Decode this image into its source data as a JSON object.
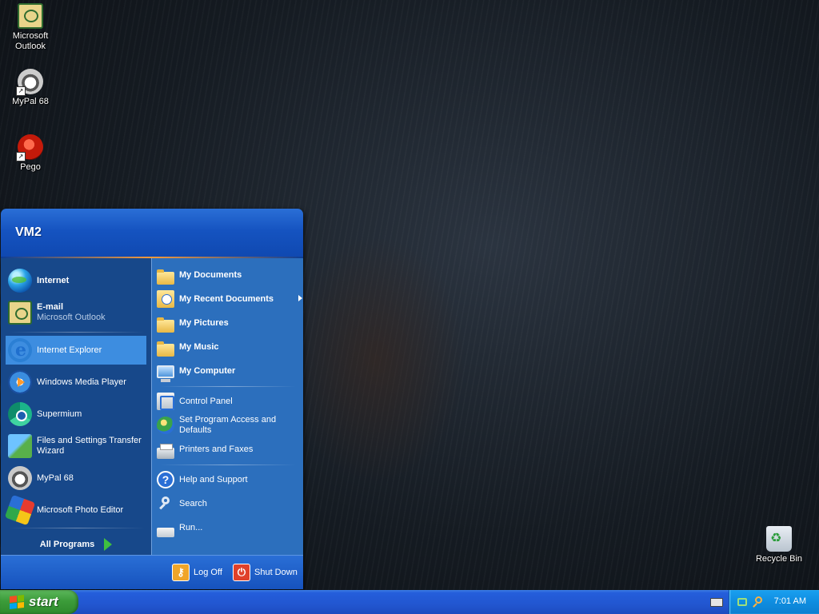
{
  "desktop": {
    "icons": [
      {
        "label_line1": "Microsoft",
        "label_line2": "Outlook",
        "icon": "outlook-icon"
      },
      {
        "label_line1": "MyPal 68",
        "label_line2": "",
        "icon": "mypal-icon"
      },
      {
        "label_line1": "Pego",
        "label_line2": "",
        "icon": "pego-icon"
      },
      {
        "label_line1": "Recycle Bin",
        "label_line2": "",
        "icon": "recycle-bin-icon"
      }
    ]
  },
  "start_menu": {
    "user_name": "VM2",
    "left": {
      "pinned": [
        {
          "title": "Internet",
          "icon": "globe-icon"
        },
        {
          "title": "E-mail",
          "subtitle": "Microsoft Outlook",
          "icon": "outlook-icon"
        }
      ],
      "recent": [
        {
          "title": "Internet Explorer",
          "icon": "internet-explorer-icon",
          "selected": true
        },
        {
          "title": "Windows Media Player",
          "icon": "media-player-icon"
        },
        {
          "title": "Supermium",
          "icon": "supermium-icon"
        },
        {
          "title_line1": "Files and Settings Transfer",
          "title_line2": "Wizard",
          "icon": "transfer-wizard-icon"
        },
        {
          "title": "MyPal 68",
          "icon": "mypal-icon"
        },
        {
          "title": "Microsoft Photo Editor",
          "icon": "photo-editor-icon"
        }
      ],
      "all_programs": "All Programs"
    },
    "right": {
      "items": [
        {
          "title": "My Documents",
          "icon": "folder-icon"
        },
        {
          "title": "My Recent Documents",
          "icon": "recent-documents-icon"
        },
        {
          "title": "My Pictures",
          "icon": "pictures-folder-icon"
        },
        {
          "title": "My Music",
          "icon": "music-folder-icon"
        },
        {
          "title": "My Computer",
          "icon": "computer-icon"
        },
        {
          "title": "Control Panel",
          "icon": "control-panel-icon"
        },
        {
          "title_line1": "Set Program Access and",
          "title_line2": "Defaults",
          "icon": "program-access-icon"
        },
        {
          "title": "Printers and Faxes",
          "icon": "printer-icon"
        },
        {
          "title": "Help and Support",
          "icon": "help-icon"
        },
        {
          "title": "Search",
          "icon": "search-icon"
        },
        {
          "title": "Run...",
          "icon": "run-icon"
        }
      ]
    },
    "footer": {
      "log_off": "Log Off",
      "shut_down": "Shut Down"
    }
  },
  "taskbar": {
    "start_label": "start",
    "clock": "7:01 AM"
  },
  "colors": {
    "taskbar_blue": "#245edb",
    "start_green": "#3c9c3a",
    "menu_left": "#17488a",
    "menu_right": "#2c6fbd",
    "selection": "#3d8de0"
  }
}
